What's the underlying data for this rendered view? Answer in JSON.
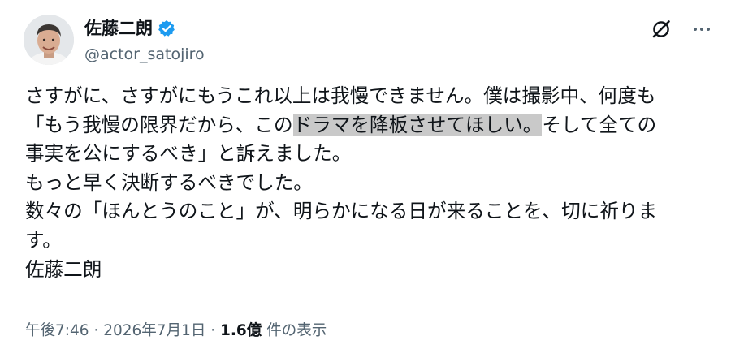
{
  "author": {
    "display_name": "佐藤二朗",
    "handle": "@actor_satojiro"
  },
  "tweet": {
    "line1": "さすがに、さすがにもうこれ以上は我慢できません。僕は撮影中、何度も",
    "line2_before": "「もう我慢の限界だから、この",
    "line2_highlight": "ドラマを降板させてほしい。",
    "line2_after": "そして全ての",
    "line3": "事実を公にするべき」と訴えました。",
    "line4": "もっと早く決断するべきでした。",
    "line5": "数々の「ほんとうのこと」が、明らかになる日が来ることを、切に祈りま",
    "line6": "す。",
    "line7": "佐藤二朗"
  },
  "meta": {
    "time": "午後7:46",
    "sep1": "·",
    "date": "2026年7月1日",
    "sep2": "·",
    "views_count": "1.6億",
    "views_label": "件の表示"
  },
  "icons": {
    "verified": "verified-badge-icon",
    "grok": "grok-icon",
    "more": "more-options-icon"
  },
  "colors": {
    "text": "#0f1419",
    "secondary": "#536471",
    "verified_blue": "#1d9bf0",
    "highlight": "#c9c9c9"
  }
}
